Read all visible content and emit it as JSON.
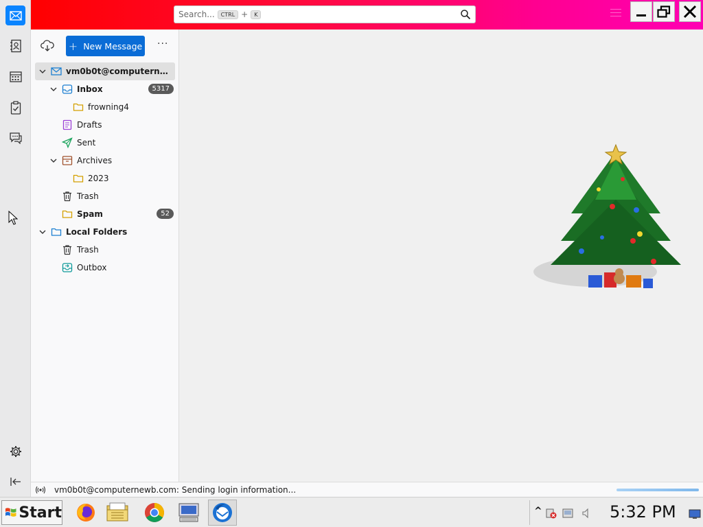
{
  "search": {
    "placeholder": "Search...",
    "key1": "CTRL",
    "plus": "+",
    "key2": "K"
  },
  "toolbar": {
    "new_message_label": "New Message",
    "more_label": "···"
  },
  "folders": {
    "account": "vm0b0t@computernewb...",
    "inbox": "Inbox",
    "inbox_count": "5317",
    "frowning4": "frowning4",
    "drafts": "Drafts",
    "sent": "Sent",
    "archives": "Archives",
    "y2023": "2023",
    "trash": "Trash",
    "spam": "Spam",
    "spam_count": "52",
    "local_folders": "Local Folders",
    "local_trash": "Trash",
    "outbox": "Outbox"
  },
  "status": {
    "text": "vm0b0t@computernewb.com: Sending login information..."
  },
  "taskbar": {
    "start_label": "Start",
    "clock": "5:32 PM"
  },
  "colors": {
    "accent": "#0a6cd6",
    "titlebar_start": "#ff0000",
    "titlebar_end": "#ff00b4"
  },
  "icons": {
    "spaces": [
      "mail-icon",
      "address-book-icon",
      "calendar-icon",
      "tasks-icon",
      "chat-icon",
      "settings-icon",
      "collapse-icon"
    ],
    "taskbar": [
      "firefox-icon",
      "file-manager-icon",
      "chrome-icon",
      "computer-icon",
      "thunderbird-icon"
    ]
  }
}
